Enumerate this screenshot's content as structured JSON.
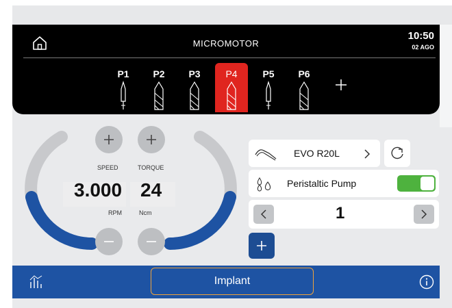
{
  "header": {
    "title": "MICROMOTOR",
    "time": "10:50",
    "date": "02 AGO"
  },
  "programs": [
    {
      "label": "P1",
      "tool": "thin-bur",
      "active": false
    },
    {
      "label": "P2",
      "tool": "drill",
      "active": false
    },
    {
      "label": "P3",
      "tool": "drill",
      "active": false
    },
    {
      "label": "P4",
      "tool": "drill",
      "active": true
    },
    {
      "label": "P5",
      "tool": "thin-bur",
      "active": false
    },
    {
      "label": "P6",
      "tool": "drill",
      "active": false
    }
  ],
  "speed": {
    "caption": "SPEED",
    "value": "3.000",
    "unit": "RPM"
  },
  "torque": {
    "caption": "TORQUE",
    "value": "24",
    "unit": "Ncm"
  },
  "handpiece": {
    "name": "EVO R20L",
    "icon": "handpiece-icon"
  },
  "pump": {
    "label": "Peristaltic Pump",
    "on": true
  },
  "irrigation_level": "1",
  "footer": {
    "mode": "Implant"
  },
  "colors": {
    "accent_blue": "#1e53a3",
    "active_red": "#e0251f",
    "toggle_green": "#4eb23e"
  }
}
